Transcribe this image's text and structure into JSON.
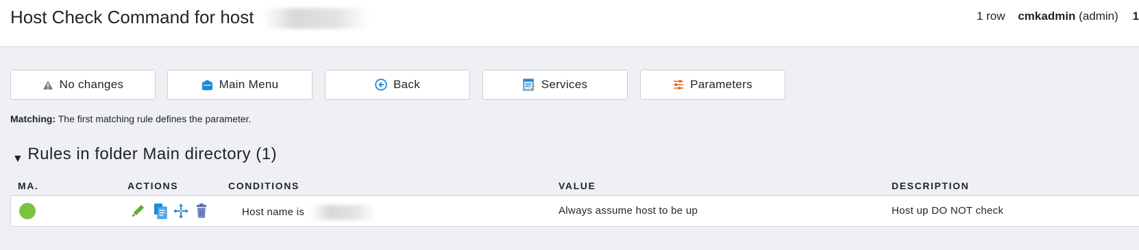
{
  "header": {
    "title": "Host Check Command for host",
    "row_count": "1 row",
    "user": "cmkadmin",
    "role": "(admin)",
    "extra": "1"
  },
  "toolbar": {
    "buttons": [
      {
        "label": "No changes",
        "icon": "warning-icon"
      },
      {
        "label": "Main Menu",
        "icon": "main-menu-icon"
      },
      {
        "label": "Back",
        "icon": "back-icon"
      },
      {
        "label": "Services",
        "icon": "services-icon"
      },
      {
        "label": "Parameters",
        "icon": "parameters-icon"
      }
    ]
  },
  "matching": {
    "label": "Matching:",
    "text": "The first matching rule defines the parameter."
  },
  "folder": {
    "title": "Rules in folder Main directory (1)"
  },
  "table": {
    "headers": [
      "MA.",
      "ACTIONS",
      "CONDITIONS",
      "VALUE",
      "DESCRIPTION"
    ],
    "rows": [
      {
        "match_status": "green-dot",
        "actions": [
          "edit-icon",
          "clone-icon",
          "move-icon",
          "delete-icon"
        ],
        "condition_prefix": "Host name is",
        "value": "Always assume host to be up",
        "description": "Host up DO NOT check"
      }
    ]
  },
  "colors": {
    "match_green": "#7cc242",
    "icon_blue": "#1e8ad6",
    "icon_orange": "#e86a1f",
    "page_bg": "#eef0f3"
  }
}
